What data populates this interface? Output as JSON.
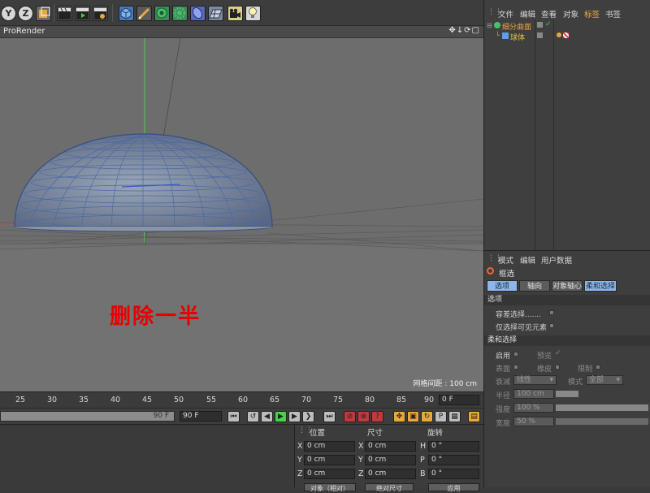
{
  "viewport": {
    "title": "ProRender",
    "nav_icons": "✥↓⟳▢",
    "grid_spacing": "网格间距 : 100 cm",
    "annotation": "删除一半"
  },
  "toolbar": {
    "axis_y": "Y",
    "axis_z": "Z"
  },
  "object_manager": {
    "menu": [
      "文件",
      "编辑",
      "查看",
      "对象",
      "标签",
      "书签"
    ],
    "active_menu": "标签",
    "objects": [
      {
        "name": "细分曲面",
        "color": "#e8a43a"
      },
      {
        "name": "球体",
        "color": "#e8c23a"
      }
    ]
  },
  "attribute_manager": {
    "menu": [
      "模式",
      "编辑",
      "用户数据"
    ],
    "title": "框选",
    "tabs": [
      "选项",
      "轴向",
      "对象轴心",
      "柔和选择"
    ],
    "section_options": "选项",
    "tolerance_select": "容差选择.......",
    "only_visible": "仅选择可见元素",
    "section_soft": "柔和选择",
    "enable": "启用",
    "preview": "预览",
    "preview_check": "✓",
    "surface": "表面",
    "rubber": "橡皮",
    "limit": "限制",
    "falloff_label": "衰减",
    "falloff_value": "线性",
    "mode_label": "模式",
    "mode_value": "全部",
    "radius_label": "半径",
    "radius_value": "100 cm",
    "strength_label": "强度",
    "strength_value": "100 %",
    "width_label": "宽度",
    "width_value": "50 %"
  },
  "timeline": {
    "ticks": [
      "25",
      "30",
      "35",
      "40",
      "45",
      "50",
      "55",
      "60",
      "65",
      "70",
      "75",
      "80",
      "85",
      "90"
    ],
    "current_frame": "0 F",
    "range_end": "90 F",
    "end_frame": "90 F"
  },
  "coordinates": {
    "headers": [
      "位置",
      "尺寸",
      "旋转"
    ],
    "rows": [
      {
        "axis": "X",
        "pos": "0 cm",
        "size_axis": "X",
        "size": "0 cm",
        "rot_axis": "H",
        "rot": "0 °"
      },
      {
        "axis": "Y",
        "pos": "0 cm",
        "size_axis": "Y",
        "size": "0 cm",
        "rot_axis": "P",
        "rot": "0 °"
      },
      {
        "axis": "Z",
        "pos": "0 cm",
        "size_axis": "Z",
        "size": "0 cm",
        "rot_axis": "B",
        "rot": "0 °"
      }
    ],
    "btn_object": "对象（相对）",
    "btn_size": "绝对尺寸",
    "btn_apply": "应用"
  }
}
